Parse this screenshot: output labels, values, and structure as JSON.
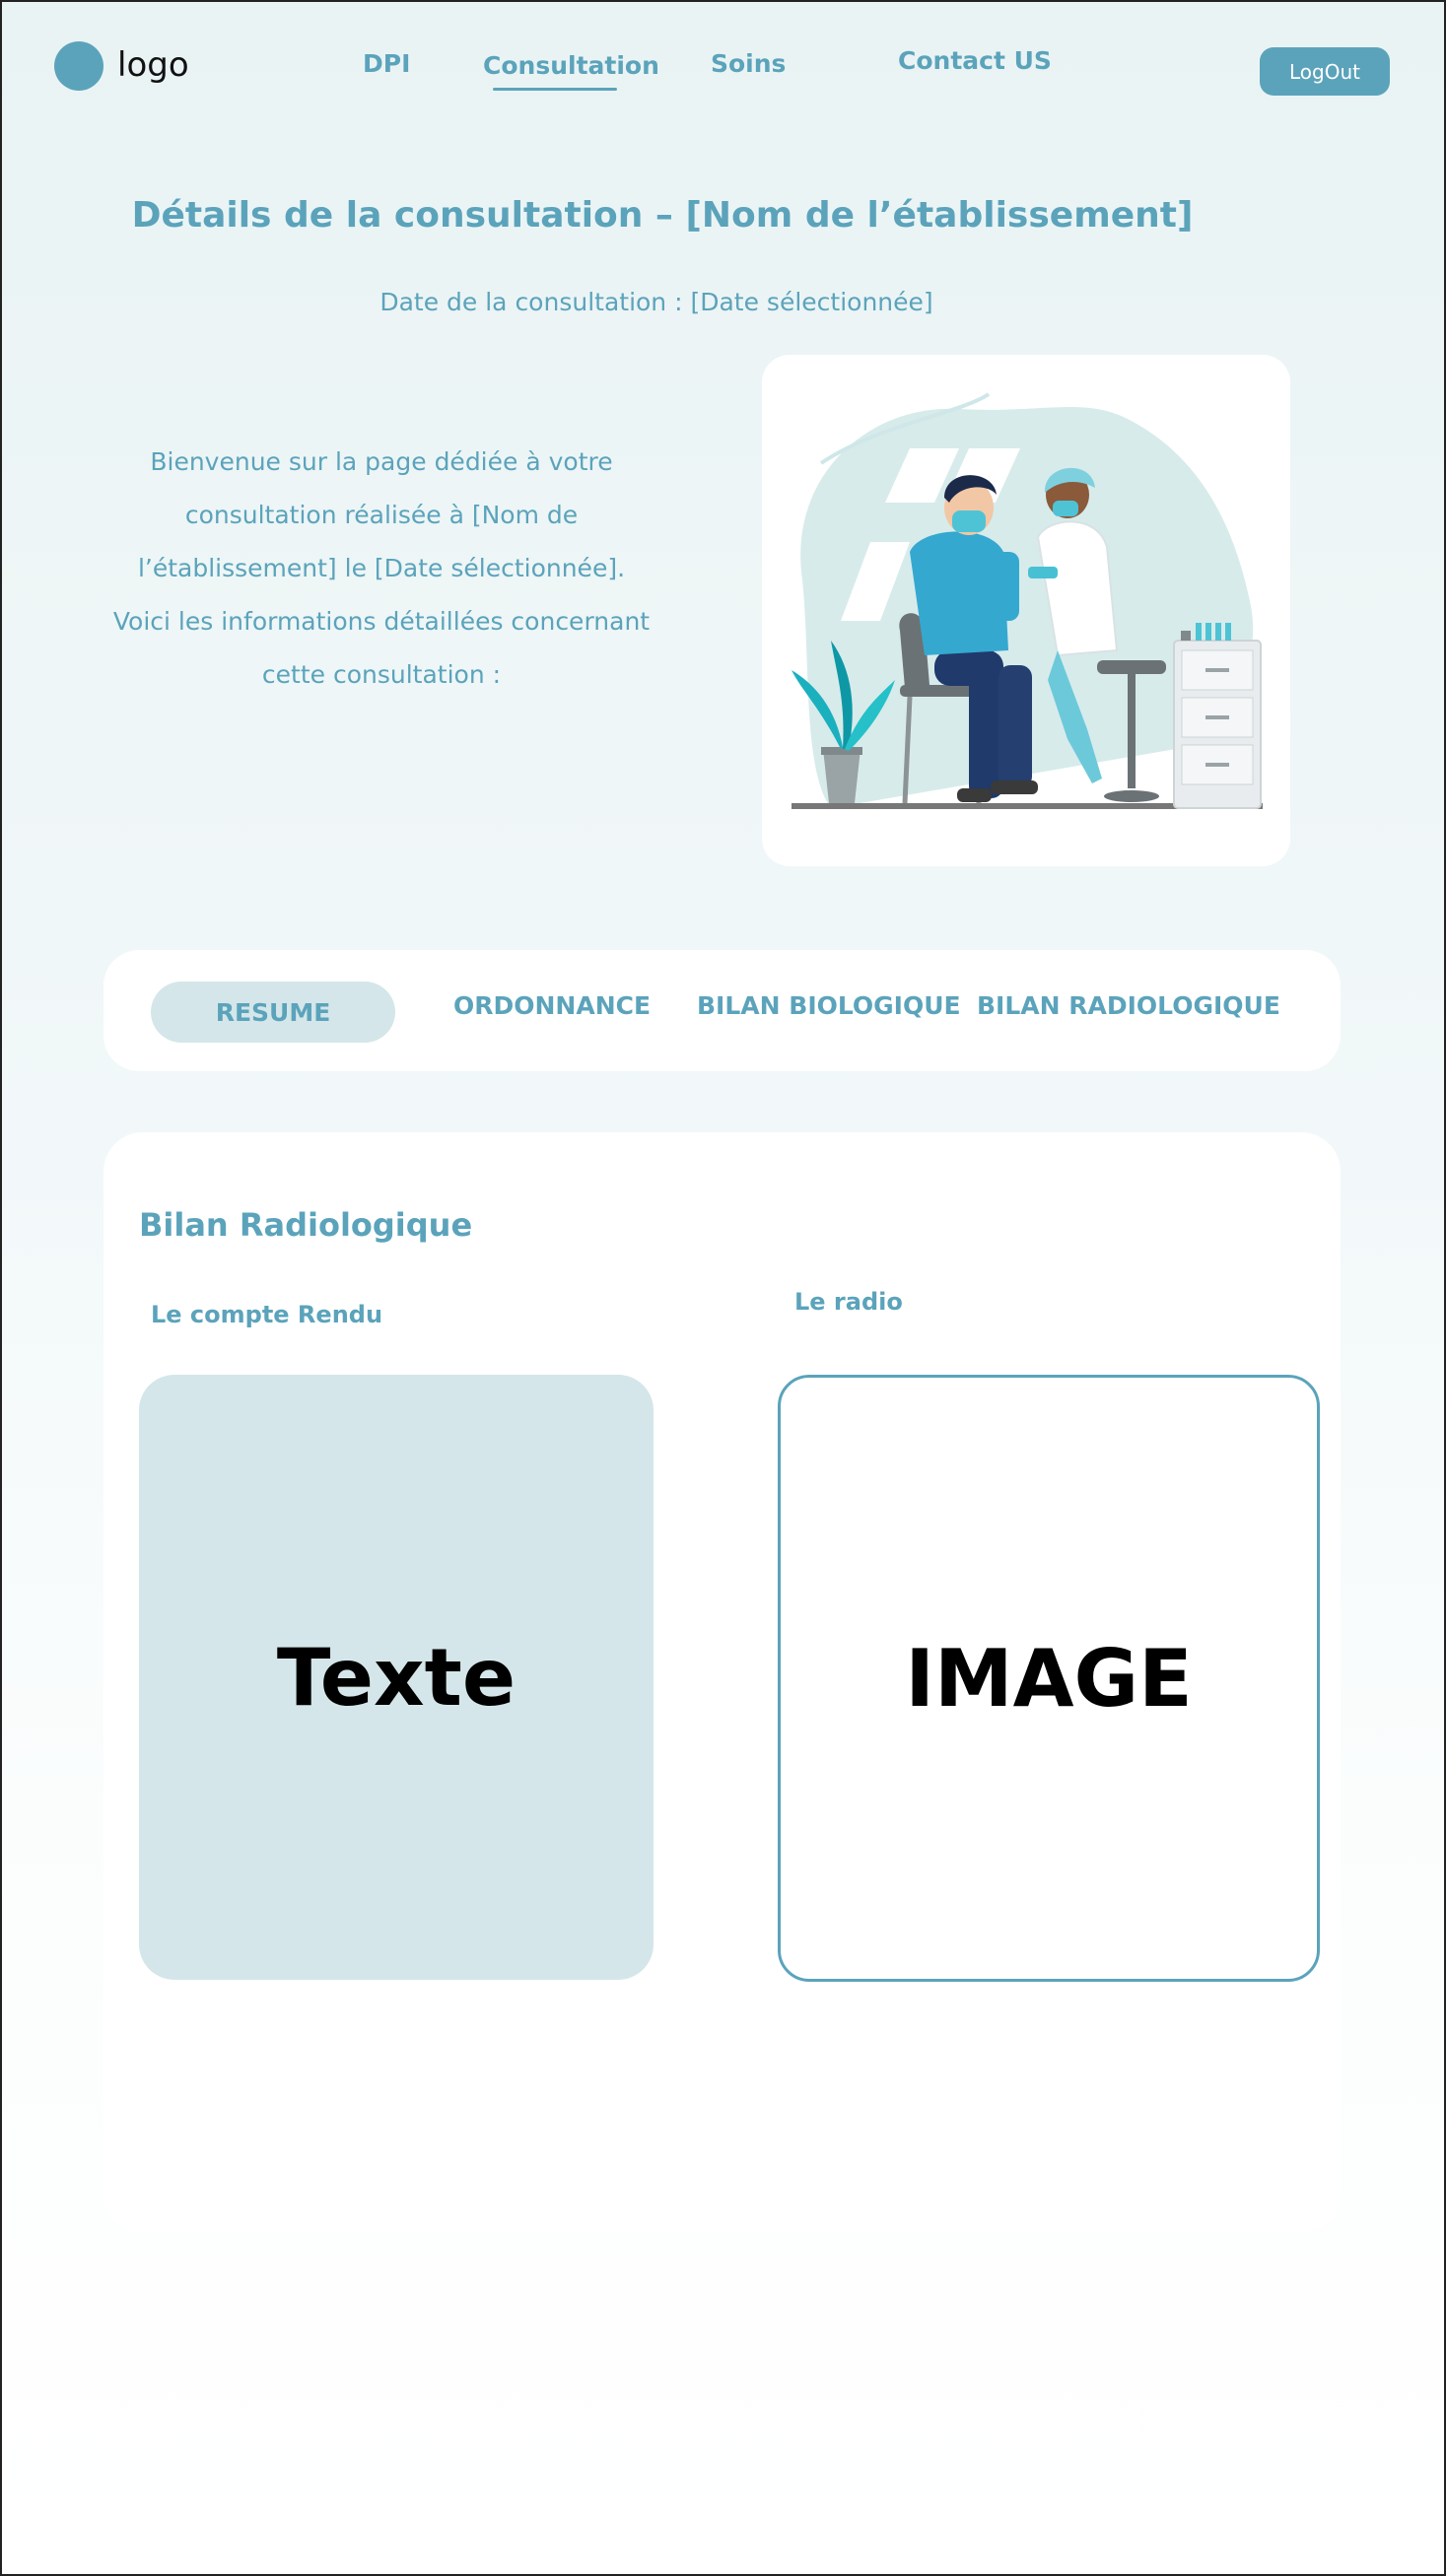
{
  "header": {
    "logo_text": "logo",
    "nav": [
      "DPI",
      "Consultation",
      "Soins",
      "Contact US"
    ],
    "active_nav": "Consultation",
    "logout_label": "LogOut"
  },
  "hero": {
    "title": "Détails de la consultation – [Nom de l’établissement]",
    "date_line": "Date de la consultation : [Date sélectionnée]",
    "intro_lines": [
      "Bienvenue sur la page dédiée à votre",
      "consultation réalisée à [Nom de",
      "l’établissement] le [Date sélectionnée].",
      "Voici les informations détaillées concernant",
      "cette consultation :"
    ]
  },
  "tabs": [
    "RESUME",
    "ORDONNANCE",
    "BILAN BIOLOGIQUE",
    "BILAN RADIOLOGIQUE"
  ],
  "active_tab": "RESUME",
  "section": {
    "title": "Bilan Radiologique",
    "report_label": "Le compte  Rendu",
    "radio_label": "Le radio",
    "report_placeholder": "Texte",
    "image_placeholder": "IMAGE"
  },
  "colors": {
    "accent": "#5ba3bb",
    "accent_light": "#d4e6e9",
    "background": "#eef6f7"
  }
}
